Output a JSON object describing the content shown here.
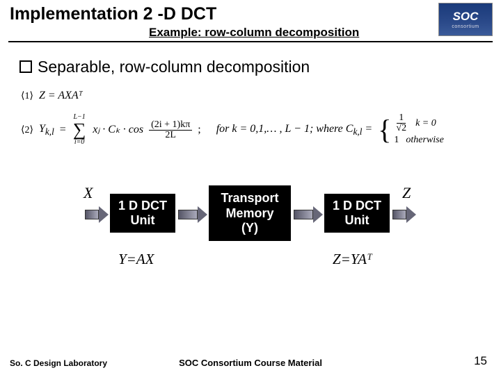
{
  "header": {
    "title": "Implementation 2 -D DCT",
    "subtitle": "Example: row-column decomposition",
    "logo_text": "SOC",
    "logo_sub": "consortium"
  },
  "bullet": {
    "text": "Separable, row-column decomposition"
  },
  "equations": {
    "eq1_label": "⟨1⟩",
    "eq1_body": "Z = AXAᵀ",
    "eq2_label": "⟨2⟩",
    "eq2_lhs": "Y",
    "eq2_sub": "k,l",
    "eq2_sum_top": "L−1",
    "eq2_sum_bot": "i=0",
    "eq2_term": "xⱼ · Cₖ · cos",
    "eq2_frac_num": "(2i + 1)kπ",
    "eq2_frac_den": "2L",
    "eq2_cond": "for  k = 0,1,… , L − 1;   where   C",
    "eq2_cond_sub": "k,l",
    "eq2_case1_val_num": "1",
    "eq2_case1_val_den": "√2",
    "eq2_case1_cond": "k = 0",
    "eq2_case2_val": "1",
    "eq2_case2_cond": "otherwise"
  },
  "diagram": {
    "input_label": "X",
    "block1": "1 D DCT\nUnit",
    "block2": "Transport\nMemory\n(Y)",
    "block3": "1 D DCT\nUnit",
    "output_label": "Z",
    "eq_left": "Y=AX",
    "eq_right": "Z=YAᵀ"
  },
  "footer": {
    "left": "So. C Design Laboratory",
    "center": "SOC Consortium Course Material",
    "page": "15"
  }
}
